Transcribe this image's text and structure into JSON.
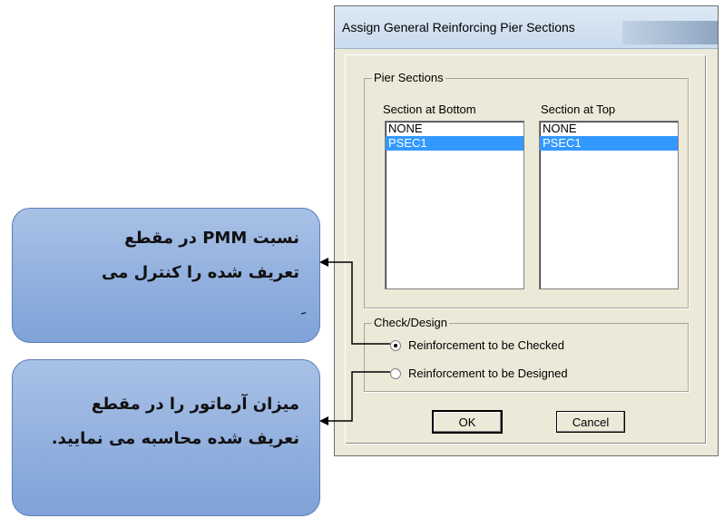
{
  "dialog": {
    "title": "Assign General Reinforcing Pier Sections",
    "pier_sections": {
      "legend": "Pier Sections",
      "bottom_label": "Section at Bottom",
      "top_label": "Section at Top",
      "bottom_items": [
        "NONE",
        "PSEC1"
      ],
      "top_items": [
        "NONE",
        "PSEC1"
      ],
      "selected": "PSEC1"
    },
    "check_design": {
      "legend": "Check/Design",
      "option_checked": "Reinforcement to be Checked",
      "option_designed": "Reinforcement to be Designed",
      "selected": "Reinforcement to be Checked"
    },
    "ok_label": "OK",
    "cancel_label": "Cancel"
  },
  "callouts": {
    "checked_line1": "نسبت PMM در مقطع",
    "checked_line2": "تعریف شده را کنترل می",
    "checked_line3": "ِ",
    "designed_line1": "میزان آرماتور را در مقطع",
    "designed_line2": "نعریف شده محاسبه می نمایید."
  },
  "colors": {
    "callout_fill": "#94b3e0",
    "selection": "#3399ff",
    "dialog_face": "#ece9d8"
  }
}
